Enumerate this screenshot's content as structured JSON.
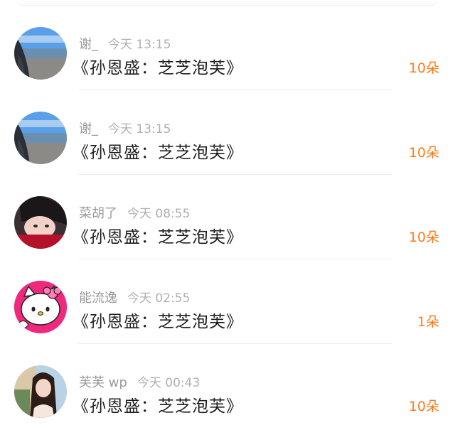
{
  "gifts": [
    {
      "user": "谢_",
      "time": "今天 13:15",
      "title": "《孙恩盛：芝芝泡芙》",
      "count": "10朵",
      "avatar_icon": "beach-photo-avatar"
    },
    {
      "user": "谢_",
      "time": "今天 13:15",
      "title": "《孙恩盛：芝芝泡芙》",
      "count": "10朵",
      "avatar_icon": "beach-photo-avatar"
    },
    {
      "user": "菜胡了",
      "time": "今天 08:55",
      "title": "《孙恩盛：芝芝泡芙》",
      "count": "10朵",
      "avatar_icon": "person-photo-avatar"
    },
    {
      "user": "能流逸",
      "time": "今天 02:55",
      "title": "《孙恩盛：芝芝泡芙》",
      "count": "1朵",
      "avatar_icon": "hello-kitty-avatar"
    },
    {
      "user": "芙芙 wp",
      "time": "今天 00:43",
      "title": "《孙恩盛：芝芝泡芙》",
      "count": "10朵",
      "avatar_icon": "selfie-photo-avatar"
    }
  ],
  "colors": {
    "accent": "#ff7a1a",
    "meta": "#9a9a9a",
    "title": "#1f1f1f"
  }
}
